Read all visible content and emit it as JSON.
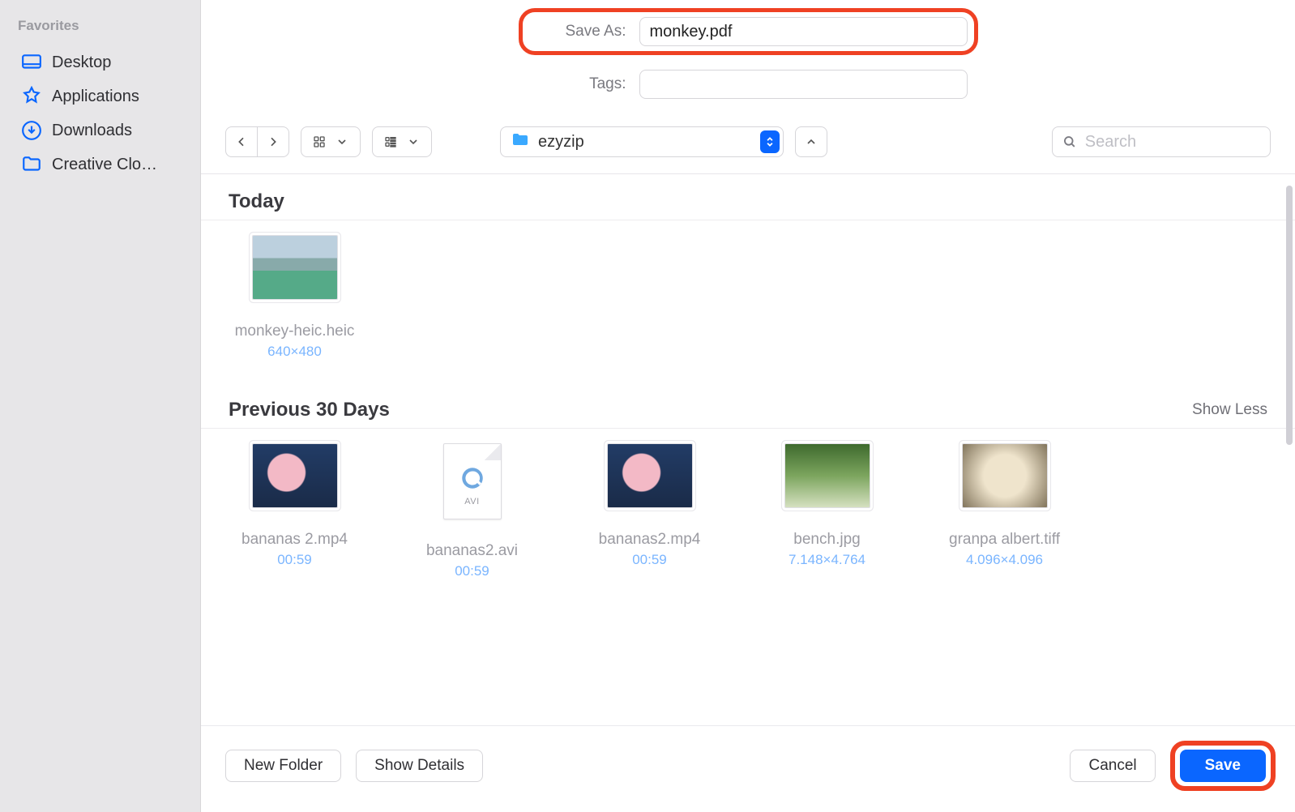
{
  "sidebar": {
    "section_title": "Favorites",
    "items": [
      {
        "label": "Desktop",
        "icon": "desktop"
      },
      {
        "label": "Applications",
        "icon": "apps"
      },
      {
        "label": "Downloads",
        "icon": "downloads"
      },
      {
        "label": "Creative Clo…",
        "icon": "folder"
      }
    ]
  },
  "form": {
    "save_as_label": "Save As:",
    "save_as_value": "monkey.pdf",
    "tags_label": "Tags:",
    "tags_value": ""
  },
  "toolbar": {
    "location_name": "ezyzip",
    "search_placeholder": "Search"
  },
  "sections": [
    {
      "title": "Today",
      "show_less": "",
      "files": [
        {
          "name": "monkey-heic.heic",
          "meta": "640×480",
          "thumb": "monkey"
        }
      ]
    },
    {
      "title": "Previous 30 Days",
      "show_less": "Show Less",
      "files": [
        {
          "name": "bananas 2.mp4",
          "meta": "00:59",
          "thumb": "smoke"
        },
        {
          "name": "bananas2.avi",
          "meta": "00:59",
          "thumb": "avi"
        },
        {
          "name": "bananas2.mp4",
          "meta": "00:59",
          "thumb": "smoke"
        },
        {
          "name": "bench.jpg",
          "meta": "7.148×4.764",
          "thumb": "bench"
        },
        {
          "name": "granpa albert.tiff",
          "meta": "4.096×4.096",
          "thumb": "granpa"
        }
      ]
    }
  ],
  "bottom": {
    "new_folder": "New Folder",
    "show_details": "Show Details",
    "cancel": "Cancel",
    "save": "Save"
  },
  "avi_ext_label": "AVI"
}
